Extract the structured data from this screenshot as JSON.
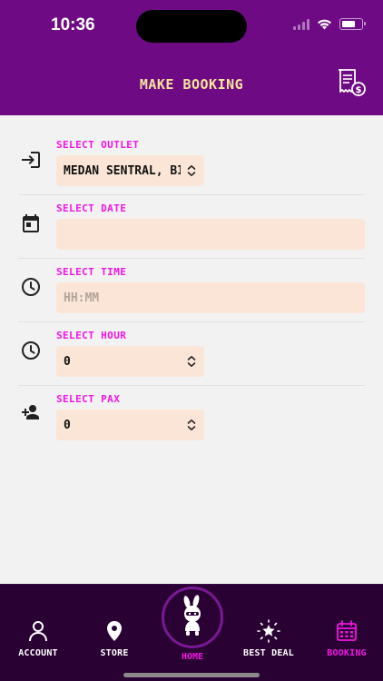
{
  "status_bar": {
    "time": "10:36"
  },
  "header": {
    "title": "MAKE BOOKING",
    "receipt_icon": "receipt-dollar-icon"
  },
  "form": {
    "outlet": {
      "label": "SELECT OUTLET",
      "value": "MEDAN SENTRAL, BII",
      "icon": "login-arrow-icon"
    },
    "date": {
      "label": "SELECT DATE",
      "value": "",
      "icon": "calendar-icon"
    },
    "time": {
      "label": "SELECT TIME",
      "placeholder": "HH:MM",
      "icon": "clock-icon"
    },
    "hour": {
      "label": "SELECT HOUR",
      "value": "0",
      "icon": "clock-icon"
    },
    "pax": {
      "label": "SELECT PAX",
      "value": "0",
      "icon": "add-person-icon"
    }
  },
  "tabbar": {
    "items": [
      {
        "label": "ACCOUNT",
        "icon": "person-icon"
      },
      {
        "label": "STORE",
        "icon": "location-pin-icon"
      },
      {
        "label": "HOME",
        "icon": "mascot-logo-icon"
      },
      {
        "label": "BEST DEAL",
        "icon": "star-badge-icon"
      },
      {
        "label": "BOOKING",
        "icon": "calendar-grid-icon"
      }
    ],
    "active_index": 4
  },
  "colors": {
    "header_bg": "#6e0a84",
    "title": "#f6e59a",
    "label_magenta": "#f215e4",
    "field_bg": "#fbe5d6",
    "tabbar_bg": "#290233"
  }
}
